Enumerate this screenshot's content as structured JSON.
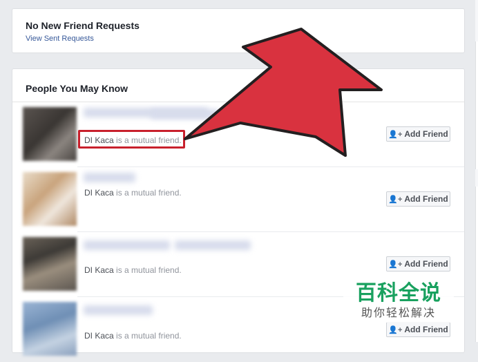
{
  "friend_requests": {
    "title": "No New Friend Requests",
    "link": "View Sent Requests"
  },
  "people_you_may_know": {
    "title": "People You May Know",
    "people": [
      {
        "mutual_friend": "DI Kaca",
        "mutual_suffix": " is a mutual friend.",
        "button": "Add Friend"
      },
      {
        "mutual_friend": "DI Kaca",
        "mutual_suffix": " is a mutual friend.",
        "button": "Add Friend"
      },
      {
        "mutual_friend": "DI Kaca",
        "mutual_suffix": " is a mutual friend.",
        "button": "Add Friend"
      },
      {
        "mutual_friend": "DI Kaca",
        "mutual_suffix": " is a mutual friend.",
        "button": "Add Friend"
      }
    ]
  },
  "watermark": {
    "main": "百科全说",
    "sub": "助你轻松解决"
  },
  "colors": {
    "link": "#365899",
    "highlight": "#c8202c",
    "arrow": "#d9323f",
    "watermark": "#19a15f"
  }
}
